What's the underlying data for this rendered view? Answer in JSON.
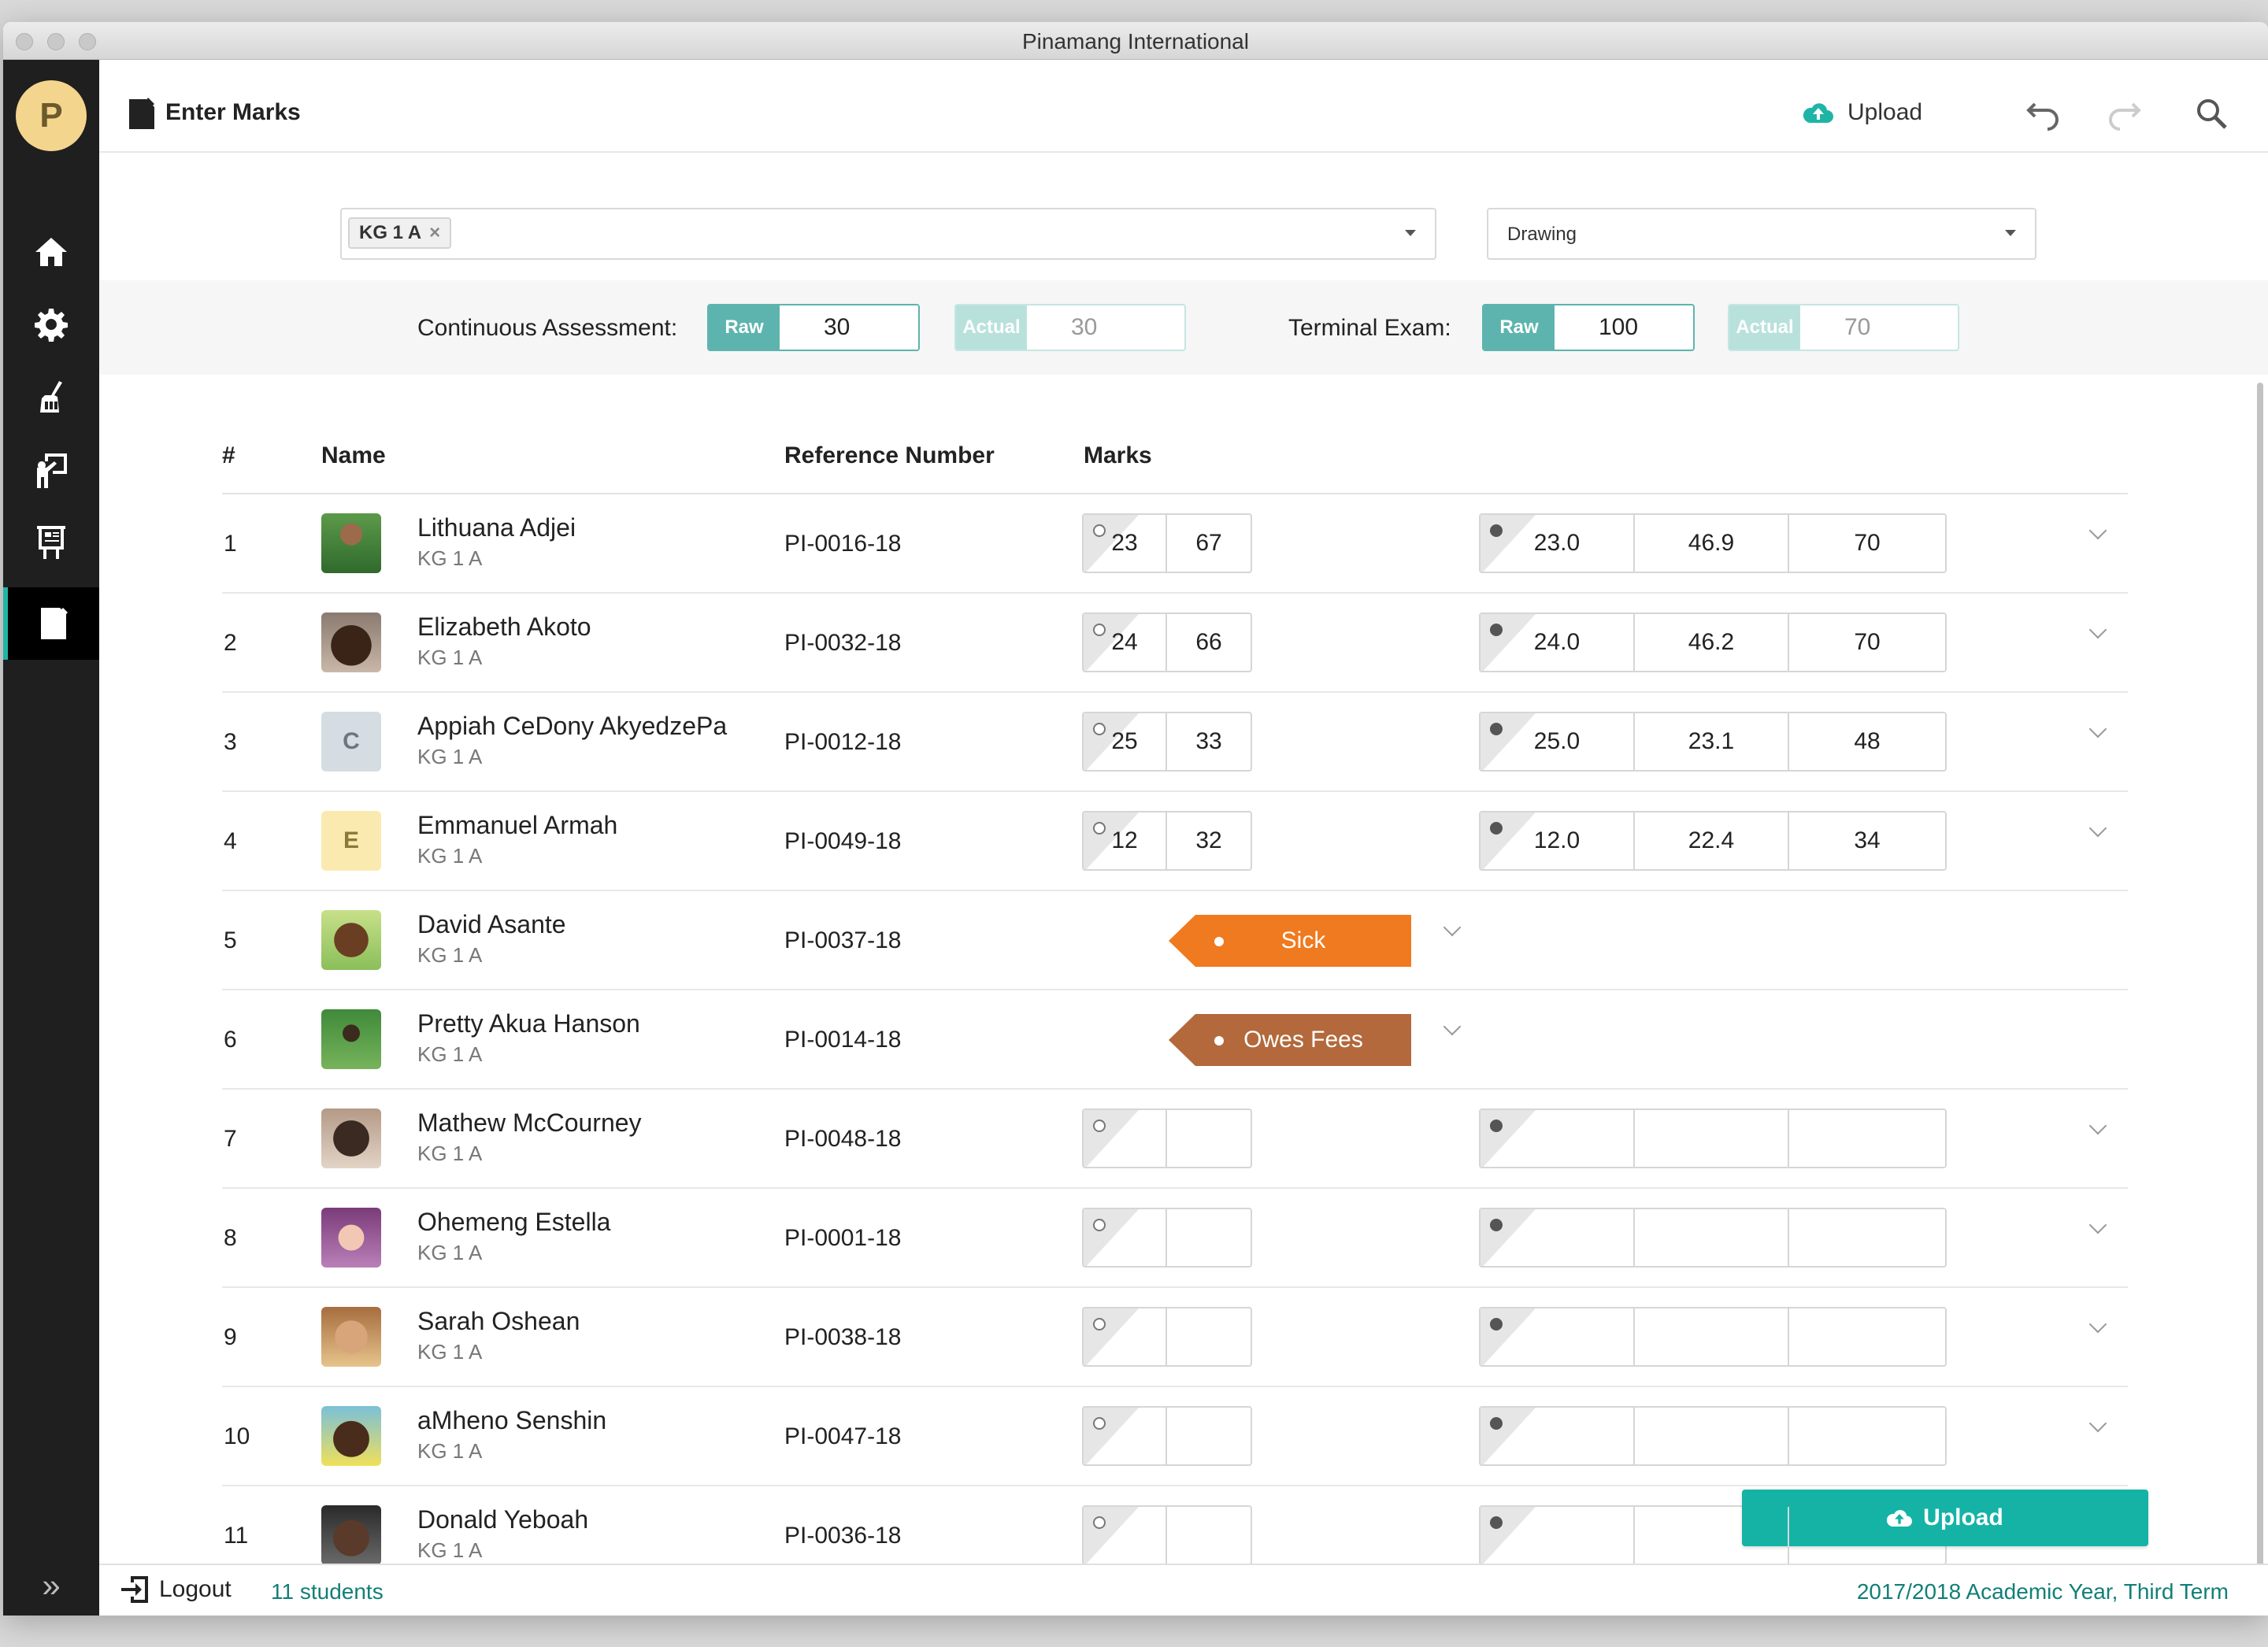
{
  "window": {
    "title": "Pinamang International"
  },
  "sidebar": {
    "avatar_letter": "P",
    "items": [
      {
        "icon": "home-icon"
      },
      {
        "icon": "gear-icon"
      },
      {
        "icon": "broom-icon"
      },
      {
        "icon": "teacher-board-icon"
      },
      {
        "icon": "easel-icon"
      },
      {
        "icon": "enter-marks-icon",
        "active": true
      }
    ]
  },
  "header": {
    "title": "Enter Marks",
    "upload_label": "Upload"
  },
  "filters": {
    "class_chip": "KG 1 A",
    "chip_remove": "×",
    "subject": "Drawing"
  },
  "weights": {
    "ca_label": "Continuous Assessment:",
    "ca_raw_tag": "Raw",
    "ca_raw": "30",
    "ca_actual_tag": "Actual",
    "ca_actual": "30",
    "exam_label": "Terminal Exam:",
    "exam_raw_tag": "Raw",
    "exam_raw": "100",
    "exam_actual_tag": "Actual",
    "exam_actual": "70"
  },
  "table": {
    "headers": {
      "num": "#",
      "name": "Name",
      "ref": "Reference Number",
      "marks": "Marks"
    },
    "rows": [
      {
        "num": "1",
        "name": "Lithuana Adjei",
        "class": "KG 1 A",
        "ref": "PI-0016-18",
        "raw": [
          "23",
          "67"
        ],
        "actual": [
          "23.0",
          "46.9",
          "70"
        ]
      },
      {
        "num": "2",
        "name": "Elizabeth Akoto",
        "class": "KG 1 A",
        "ref": "PI-0032-18",
        "raw": [
          "24",
          "66"
        ],
        "actual": [
          "24.0",
          "46.2",
          "70"
        ]
      },
      {
        "num": "3",
        "name": "Appiah CeDony AkyedzePa",
        "class": "KG 1 A",
        "ref": "PI-0012-18",
        "initial": "C",
        "raw": [
          "25",
          "33"
        ],
        "actual": [
          "25.0",
          "23.1",
          "48"
        ]
      },
      {
        "num": "4",
        "name": "Emmanuel Armah",
        "class": "KG 1 A",
        "ref": "PI-0049-18",
        "initial": "E",
        "raw": [
          "12",
          "32"
        ],
        "actual": [
          "12.0",
          "22.4",
          "34"
        ]
      },
      {
        "num": "5",
        "name": "David Asante",
        "class": "KG 1 A",
        "ref": "PI-0037-18",
        "status": "Sick"
      },
      {
        "num": "6",
        "name": "Pretty Akua Hanson",
        "class": "KG 1 A",
        "ref": "PI-0014-18",
        "status": "Owes Fees"
      },
      {
        "num": "7",
        "name": "Mathew McCourney",
        "class": "KG 1 A",
        "ref": "PI-0048-18",
        "raw": [
          "",
          ""
        ],
        "actual": [
          "",
          "",
          ""
        ]
      },
      {
        "num": "8",
        "name": "Ohemeng Estella",
        "class": "KG 1 A",
        "ref": "PI-0001-18",
        "raw": [
          "",
          ""
        ],
        "actual": [
          "",
          "",
          ""
        ]
      },
      {
        "num": "9",
        "name": "Sarah Oshean",
        "class": "KG 1 A",
        "ref": "PI-0038-18",
        "raw": [
          "",
          ""
        ],
        "actual": [
          "",
          "",
          ""
        ]
      },
      {
        "num": "10",
        "name": "aMheno Senshin",
        "class": "KG 1 A",
        "ref": "PI-0047-18",
        "raw": [
          "",
          ""
        ],
        "actual": [
          "",
          "",
          ""
        ]
      },
      {
        "num": "11",
        "name": "Donald Yeboah",
        "class": "KG 1 A",
        "ref": "PI-0036-18",
        "raw": [
          "",
          ""
        ],
        "actual": [
          "",
          "",
          ""
        ]
      }
    ]
  },
  "upload_button": "Upload",
  "footer": {
    "logout": "Logout",
    "student_count": "11 students",
    "term": "2017/2018 Academic Year,  Third Term"
  },
  "colors": {
    "accent": "#14b3a6",
    "sidebar": "#1f1f1f",
    "sick": "#f07a1f",
    "owes_fees": "#b3693b",
    "link": "#127f77"
  }
}
